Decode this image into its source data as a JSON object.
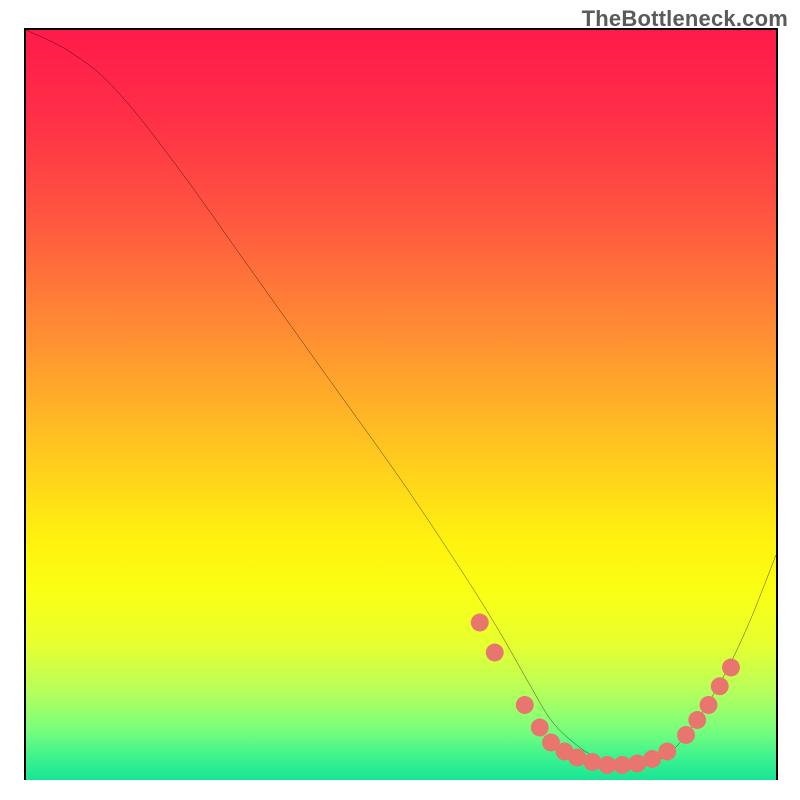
{
  "attribution": "TheBottleneck.com",
  "chart_data": {
    "type": "line",
    "title": "",
    "xlabel": "",
    "ylabel": "",
    "xlim": [
      0,
      100
    ],
    "ylim": [
      0,
      100
    ],
    "grid": false,
    "legend": false,
    "gradient_stops": [
      {
        "offset": 0.0,
        "color": "#ff1a4b"
      },
      {
        "offset": 0.12,
        "color": "#ff3047"
      },
      {
        "offset": 0.25,
        "color": "#ff5640"
      },
      {
        "offset": 0.4,
        "color": "#ff8c34"
      },
      {
        "offset": 0.55,
        "color": "#ffc321"
      },
      {
        "offset": 0.68,
        "color": "#fff20e"
      },
      {
        "offset": 0.75,
        "color": "#fbff14"
      },
      {
        "offset": 0.82,
        "color": "#e6ff30"
      },
      {
        "offset": 0.88,
        "color": "#b8ff5a"
      },
      {
        "offset": 0.93,
        "color": "#7dff7a"
      },
      {
        "offset": 0.97,
        "color": "#3cf38e"
      },
      {
        "offset": 1.0,
        "color": "#19e595"
      }
    ],
    "series": [
      {
        "name": "bottleneck-curve",
        "color": "#000000",
        "x": [
          0,
          6,
          12,
          20,
          30,
          40,
          50,
          58,
          63,
          67,
          70,
          73,
          76,
          79,
          82,
          85,
          88,
          92,
          96,
          100
        ],
        "y": [
          100,
          97,
          92,
          82,
          68,
          54,
          40,
          28,
          20,
          13,
          8,
          5,
          3,
          2,
          2,
          3,
          6,
          12,
          20,
          30
        ]
      }
    ],
    "dots": {
      "name": "highlight-dots",
      "color": "#e9766e",
      "radius": 9,
      "points": [
        {
          "x": 60.5,
          "y": 21.0
        },
        {
          "x": 62.5,
          "y": 17.0
        },
        {
          "x": 66.5,
          "y": 10.0
        },
        {
          "x": 68.5,
          "y": 7.0
        },
        {
          "x": 70.0,
          "y": 5.0
        },
        {
          "x": 71.8,
          "y": 3.8
        },
        {
          "x": 73.5,
          "y": 3.0
        },
        {
          "x": 75.5,
          "y": 2.4
        },
        {
          "x": 77.5,
          "y": 2.0
        },
        {
          "x": 79.5,
          "y": 2.0
        },
        {
          "x": 81.5,
          "y": 2.2
        },
        {
          "x": 83.5,
          "y": 2.8
        },
        {
          "x": 85.5,
          "y": 3.8
        },
        {
          "x": 88.0,
          "y": 6.0
        },
        {
          "x": 89.5,
          "y": 8.0
        },
        {
          "x": 91.0,
          "y": 10.0
        },
        {
          "x": 92.5,
          "y": 12.5
        },
        {
          "x": 94.0,
          "y": 15.0
        }
      ]
    }
  }
}
